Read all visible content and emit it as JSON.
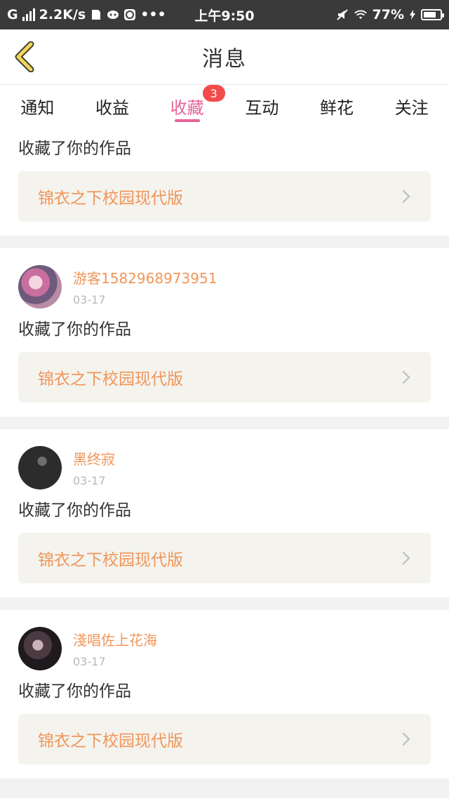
{
  "status_bar": {
    "carrier": "G",
    "speed": "2.2K/s",
    "time": "上午9:50",
    "battery": "77%",
    "battery_level": 0.77
  },
  "navbar": {
    "title": "消息"
  },
  "tabs": [
    {
      "label": "通知",
      "active": false
    },
    {
      "label": "收益",
      "active": false
    },
    {
      "label": "收藏",
      "active": true,
      "badge": "3"
    },
    {
      "label": "互动",
      "active": false
    },
    {
      "label": "鲜花",
      "active": false
    },
    {
      "label": "关注",
      "active": false
    }
  ],
  "feed": {
    "first": {
      "message": "收藏了你的作品",
      "work_title": "锦衣之下校园现代版"
    },
    "items": [
      {
        "username": "游客1582968973951",
        "date": "03-17",
        "message": "收藏了你的作品",
        "work_title": "锦衣之下校园现代版"
      },
      {
        "username": "黑终寂",
        "date": "03-17",
        "message": "收藏了你的作品",
        "work_title": "锦衣之下校园现代版"
      },
      {
        "username": "淺唱佐上花海",
        "date": "03-17",
        "message": "收藏了你的作品",
        "work_title": "锦衣之下校园现代版"
      }
    ]
  },
  "colors": {
    "accent_pink": "#e8639a",
    "username_orange": "#f0965a",
    "badge_red": "#f24b4b"
  }
}
